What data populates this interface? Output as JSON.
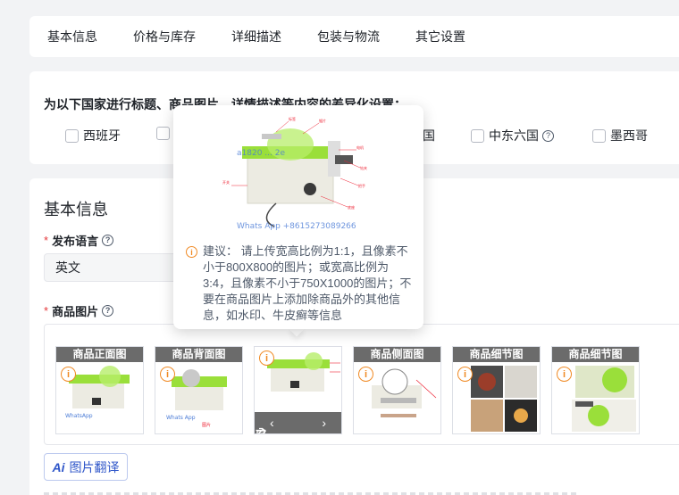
{
  "tabs": [
    "基本信息",
    "价格与库存",
    "详细描述",
    "包装与物流",
    "其它设置"
  ],
  "countries": {
    "title": "为以下国家进行标题、商品图片、详情描述等内容的差异化设置：",
    "options": [
      "西班牙",
      "",
      "国",
      "中东六国",
      "墨西哥"
    ],
    "help_icon": "question-circle-icon"
  },
  "basic": {
    "title": "基本信息",
    "language_label": "发布语言",
    "language_value": "英文",
    "images_label": "商品图片",
    "required_mark": "*"
  },
  "images": [
    {
      "caption": "商品正面图",
      "warn": "i"
    },
    {
      "caption": "商品背面图",
      "warn": "i"
    },
    {
      "caption": "",
      "warn": "i"
    },
    {
      "caption": "商品侧面图",
      "warn": "i"
    },
    {
      "caption": "商品细节图",
      "warn": "i"
    },
    {
      "caption": "商品细节图",
      "warn": "i"
    }
  ],
  "image_tools": {
    "prev": "‹",
    "next": "›",
    "edit_icon": "edit-icon",
    "delete_icon": "trash-icon"
  },
  "translate_button": {
    "ai": "Ai",
    "label": "图片翻译"
  },
  "popover": {
    "watermark_top": "a1820 ... 2e",
    "watermark_bottom": "Whats App  +8615273089266",
    "tip": "建议： 请上传宽高比例为1:1，且像素不小于800X800的图片；或宽高比例为3:4，且像素不小于750X1000的图片；不要在商品图片上添加除商品外的其他信息，如水印、牛皮癣等信息"
  },
  "colors": {
    "accent": "#2f56c9",
    "warning": "#f08a24",
    "required": "#e5393c",
    "machine_green": "#9adf3a"
  }
}
